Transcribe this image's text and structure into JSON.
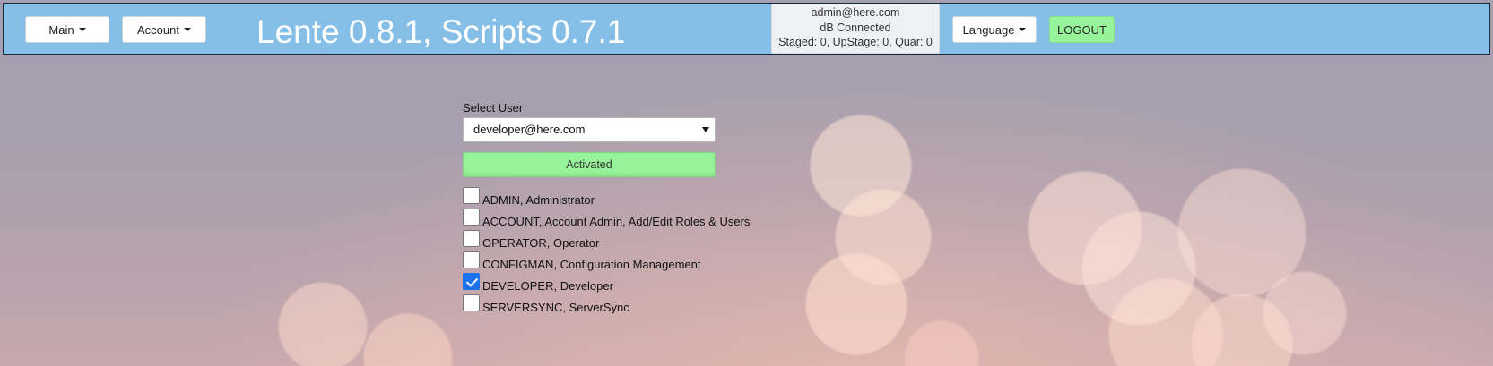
{
  "header": {
    "main_menu_label": "Main",
    "account_menu_label": "Account",
    "title": "Lente 0.8.1, Scripts 0.7.1",
    "status": {
      "user": "admin@here.com",
      "db": "dB Connected",
      "counts": "Staged: 0, UpStage: 0, Quar: 0"
    },
    "language_menu_label": "Language",
    "logout_label": "LOGOUT"
  },
  "user_form": {
    "select_label": "Select User",
    "selected_user": "developer@here.com",
    "status_label": "Activated",
    "roles": [
      {
        "label": "ADMIN, Administrator",
        "checked": false
      },
      {
        "label": "ACCOUNT, Account Admin, Add/Edit Roles & Users",
        "checked": false
      },
      {
        "label": "OPERATOR, Operator",
        "checked": false
      },
      {
        "label": "CONFIGMAN, Configuration Management",
        "checked": false
      },
      {
        "label": "DEVELOPER, Developer",
        "checked": true
      },
      {
        "label": "SERVERSYNC, ServerSync",
        "checked": false
      }
    ]
  },
  "colors": {
    "header_bg": "#85bfe8",
    "accent_green": "#98f49a",
    "checkbox_checked": "#1a73e8"
  },
  "icons": {
    "menu_caret": "caret-down-icon",
    "select_arrow": "dropdown-arrow-icon",
    "check": "checkmark-icon"
  }
}
